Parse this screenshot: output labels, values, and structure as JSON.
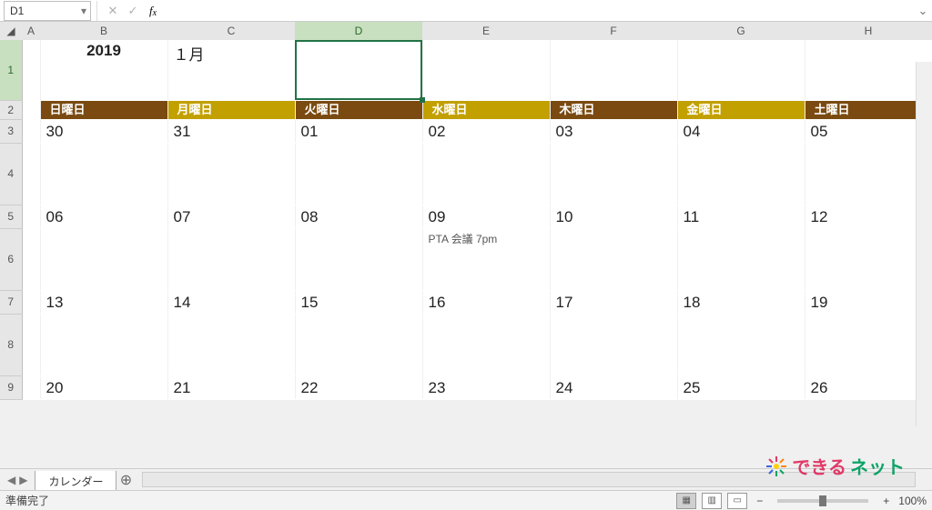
{
  "formula_bar": {
    "name_box_value": "D1",
    "formula_value": ""
  },
  "columns": [
    "A",
    "B",
    "C",
    "D",
    "E",
    "F",
    "G",
    "H"
  ],
  "selected_column_index": 3,
  "selected_row_label": "1",
  "row_labels": [
    "1",
    "2",
    "3",
    "4",
    "5",
    "6",
    "7",
    "8",
    "9"
  ],
  "calendar": {
    "year": "2019",
    "month_label": "１月",
    "day_headers": [
      "日曜日",
      "月曜日",
      "火曜日",
      "水曜日",
      "木曜日",
      "金曜日",
      "土曜日"
    ],
    "weeks": [
      {
        "dates": [
          "30",
          "31",
          "01",
          "02",
          "03",
          "04",
          "05"
        ],
        "grey": [
          true,
          true,
          false,
          false,
          false,
          false,
          false
        ],
        "events": [
          "",
          "",
          "",
          "",
          "",
          "",
          ""
        ]
      },
      {
        "dates": [
          "06",
          "07",
          "08",
          "09",
          "10",
          "11",
          "12"
        ],
        "grey": [
          false,
          false,
          false,
          false,
          false,
          false,
          false
        ],
        "events": [
          "",
          "",
          "",
          "PTA 会議 7pm",
          "",
          "",
          ""
        ]
      },
      {
        "dates": [
          "13",
          "14",
          "15",
          "16",
          "17",
          "18",
          "19"
        ],
        "grey": [
          false,
          false,
          false,
          false,
          false,
          false,
          false
        ],
        "events": [
          "",
          "",
          "",
          "",
          "",
          "",
          ""
        ]
      },
      {
        "dates": [
          "20",
          "21",
          "22",
          "23",
          "24",
          "25",
          "26"
        ],
        "grey": [
          false,
          false,
          false,
          false,
          false,
          false,
          false
        ],
        "events": [
          "",
          "",
          "",
          "",
          "",
          "",
          ""
        ]
      }
    ]
  },
  "sheet_tabs": {
    "active": "カレンダー"
  },
  "statusbar": {
    "ready": "準備完了",
    "zoom": "100%"
  },
  "watermark": {
    "part1": "できる",
    "part2": "ネット"
  }
}
